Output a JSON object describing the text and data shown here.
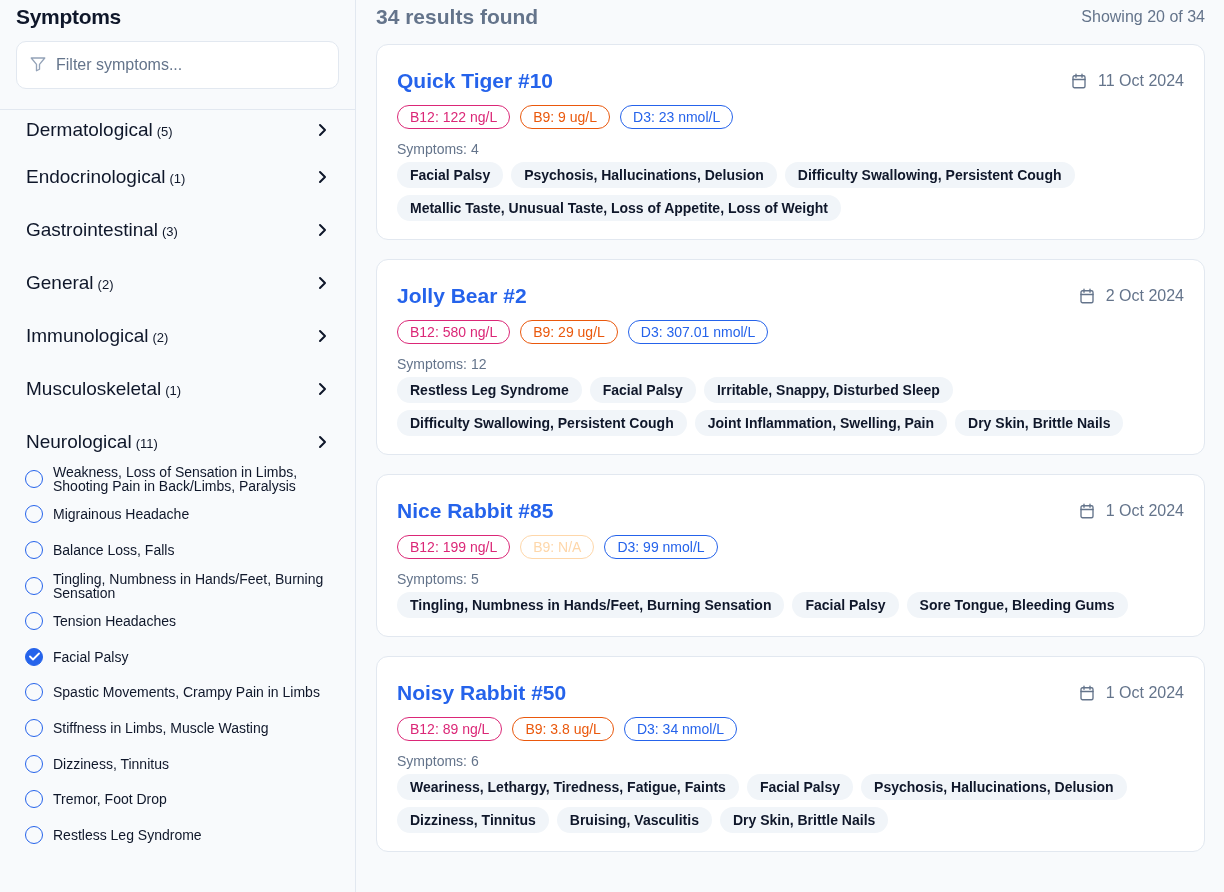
{
  "sidebar": {
    "title": "Symptoms",
    "filter": {
      "placeholder": "Filter symptoms..."
    },
    "categories": [
      {
        "name": "Dermatological",
        "count": "(5)"
      },
      {
        "name": "Endocrinological",
        "count": "(1)"
      },
      {
        "name": "Gastrointestinal",
        "count": "(3)"
      },
      {
        "name": "General",
        "count": "(2)"
      },
      {
        "name": "Immunological",
        "count": "(2)"
      },
      {
        "name": "Musculoskeletal",
        "count": "(1)"
      },
      {
        "name": "Neurological",
        "count": "(11)",
        "children": [
          {
            "label": "Weakness, Loss of Sensation in Limbs, Shooting Pain in Back/Limbs, Paralysis",
            "checked": false
          },
          {
            "label": "Migrainous Headache",
            "checked": false
          },
          {
            "label": "Balance Loss, Falls",
            "checked": false
          },
          {
            "label": "Tingling, Numbness in Hands/Feet, Burning Sensation",
            "checked": false
          },
          {
            "label": "Tension Headaches",
            "checked": false
          },
          {
            "label": "Facial Palsy",
            "checked": true
          },
          {
            "label": "Spastic Movements, Crampy Pain in Limbs",
            "checked": false
          },
          {
            "label": "Stiffness in Limbs, Muscle Wasting",
            "checked": false
          },
          {
            "label": "Dizziness, Tinnitus",
            "checked": false
          },
          {
            "label": "Tremor, Foot Drop",
            "checked": false
          },
          {
            "label": "Restless Leg Syndrome",
            "checked": false
          }
        ]
      }
    ]
  },
  "results": {
    "heading": "34 results found",
    "showing": "Showing 20 of 34",
    "cards": [
      {
        "title": "Quick Tiger #10",
        "date": "11 Oct 2024",
        "levels": [
          {
            "kind": "b12",
            "text": "B12: 122 ng/L",
            "missing": false
          },
          {
            "kind": "b9",
            "text": "B9: 9 ug/L",
            "missing": false
          },
          {
            "kind": "d3",
            "text": "D3: 23 nmol/L",
            "missing": false
          }
        ],
        "symptoms_label": "Symptoms: 4",
        "symptoms": [
          "Facial Palsy",
          "Psychosis, Hallucinations, Delusion",
          "Difficulty Swallowing, Persistent Cough",
          "Metallic Taste, Unusual Taste, Loss of Appetite, Loss of Weight"
        ]
      },
      {
        "title": "Jolly Bear #2",
        "date": "2 Oct 2024",
        "levels": [
          {
            "kind": "b12",
            "text": "B12: 580 ng/L",
            "missing": false
          },
          {
            "kind": "b9",
            "text": "B9: 29 ug/L",
            "missing": false
          },
          {
            "kind": "d3",
            "text": "D3: 307.01 nmol/L",
            "missing": false
          }
        ],
        "symptoms_label": "Symptoms: 12",
        "symptoms": [
          "Restless Leg Syndrome",
          "Facial Palsy",
          "Irritable, Snappy, Disturbed Sleep",
          "Difficulty Swallowing, Persistent Cough",
          "Joint Inflammation, Swelling, Pain",
          "Dry Skin, Brittle Nails"
        ]
      },
      {
        "title": "Nice Rabbit #85",
        "date": "1 Oct 2024",
        "levels": [
          {
            "kind": "b12",
            "text": "B12: 199 ng/L",
            "missing": false
          },
          {
            "kind": "b9",
            "text": "B9: N/A",
            "missing": true
          },
          {
            "kind": "d3",
            "text": "D3: 99 nmol/L",
            "missing": false
          }
        ],
        "symptoms_label": "Symptoms: 5",
        "symptoms": [
          "Tingling, Numbness in Hands/Feet, Burning Sensation",
          "Facial Palsy",
          "Sore Tongue, Bleeding Gums"
        ]
      },
      {
        "title": "Noisy Rabbit #50",
        "date": "1 Oct 2024",
        "levels": [
          {
            "kind": "b12",
            "text": "B12: 89 ng/L",
            "missing": false
          },
          {
            "kind": "b9",
            "text": "B9: 3.8 ug/L",
            "missing": false
          },
          {
            "kind": "d3",
            "text": "D3: 34 nmol/L",
            "missing": false
          }
        ],
        "symptoms_label": "Symptoms: 6",
        "symptoms": [
          "Weariness, Lethargy, Tiredness, Fatigue, Faints",
          "Facial Palsy",
          "Psychosis, Hallucinations, Delusion",
          "Dizziness, Tinnitus",
          "Bruising, Vasculitis",
          "Dry Skin, Brittle Nails"
        ]
      }
    ]
  }
}
